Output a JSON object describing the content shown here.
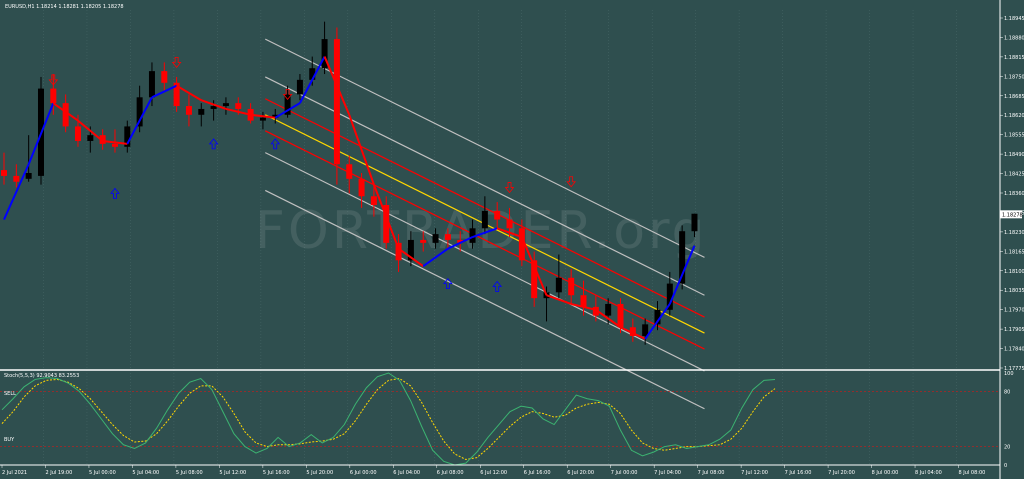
{
  "colors": {
    "background": "#2f4f4f",
    "grid": "#4a6a6a",
    "bull_candle": "#000000",
    "bear_candle": "#ff0000",
    "ma_down": "#ff0000",
    "ma_up": "#0000ff",
    "channel_outer": "#c0c0c0",
    "channel_inner": "#ff0000",
    "channel_mid": "#ffd700",
    "stoch_main": "#3cb371",
    "stoch_signal": "#ffd700",
    "level_line": "#b22222",
    "axis_text": "#ffffff",
    "current_price_box": "#ffffff"
  },
  "header": {
    "title": "EURUSD,H1  1.18214 1.18281 1.18205 1.18278"
  },
  "watermark": "FORTRADER.org",
  "price_axis": {
    "labels": [
      "1.18945",
      "1.18880",
      "1.18815",
      "1.18750",
      "1.18685",
      "1.18620",
      "1.18555",
      "1.18490",
      "1.18425",
      "1.18360",
      "1.18295",
      "1.18230",
      "1.18165",
      "1.18100",
      "1.18035",
      "1.17970",
      "1.17905",
      "1.17840",
      "1.17775"
    ],
    "current_price": "1.18278"
  },
  "time_axis": {
    "labels": [
      "2 Jul 2021",
      "2 Jul 19:00",
      "5 Jul 00:00",
      "5 Jul 04:00",
      "5 Jul 08:00",
      "5 Jul 12:00",
      "5 Jul 16:00",
      "5 Jul 20:00",
      "6 Jul 00:00",
      "6 Jul 04:00",
      "6 Jul 08:00",
      "6 Jul 12:00",
      "6 Jul 16:00",
      "6 Jul 20:00",
      "7 Jul 00:00",
      "7 Jul 04:00",
      "7 Jul 08:00",
      "7 Jul 12:00",
      "7 Jul 16:00",
      "7 Jul 20:00",
      "8 Jul 00:00",
      "8 Jul 04:00",
      "8 Jul 08:00"
    ]
  },
  "stochastic": {
    "title": "Stoch(5,5,3) 92.9043 83.2553",
    "sell_label": "SELL",
    "buy_label": "BUY",
    "axis_labels": [
      "100",
      "80",
      "20",
      "0"
    ],
    "upper_level": 80,
    "lower_level": 20,
    "main": [
      60,
      72,
      85,
      93,
      95,
      94,
      89,
      80,
      66,
      50,
      34,
      22,
      18,
      24,
      40,
      60,
      78,
      90,
      94,
      82,
      58,
      34,
      20,
      13,
      18,
      30,
      20,
      24,
      33,
      24,
      30,
      44,
      66,
      84,
      96,
      100,
      92,
      70,
      42,
      16,
      4,
      0,
      2,
      14,
      30,
      44,
      58,
      64,
      62,
      50,
      44,
      60,
      76,
      72,
      70,
      64,
      38,
      16,
      10,
      14,
      20,
      22,
      18,
      20,
      22,
      28,
      38,
      62,
      82,
      92,
      93
    ],
    "signal": [
      45,
      58,
      74,
      86,
      92,
      93,
      90,
      83,
      72,
      58,
      44,
      32,
      25,
      26,
      34,
      48,
      64,
      78,
      86,
      86,
      74,
      56,
      36,
      24,
      20,
      22,
      22,
      23,
      25,
      26,
      28,
      34,
      48,
      66,
      82,
      92,
      94,
      86,
      68,
      46,
      26,
      12,
      6,
      8,
      18,
      30,
      42,
      52,
      58,
      56,
      52,
      54,
      62,
      66,
      68,
      66,
      56,
      38,
      24,
      18,
      16,
      18,
      20,
      20,
      21,
      22,
      28,
      40,
      58,
      74,
      83
    ]
  },
  "chart_data": {
    "type": "candlestick",
    "title": "EURUSD,H1  1.18214 1.18281 1.18205 1.18278",
    "y_range": [
      1.1775,
      1.1898
    ],
    "candles": [
      {
        "o": 1.1843,
        "h": 1.1849,
        "l": 1.1838,
        "c": 1.1841
      },
      {
        "o": 1.1841,
        "h": 1.1845,
        "l": 1.1837,
        "c": 1.1839
      },
      {
        "o": 1.184,
        "h": 1.1855,
        "l": 1.1839,
        "c": 1.1842
      },
      {
        "o": 1.1841,
        "h": 1.1875,
        "l": 1.1838,
        "c": 1.1871
      },
      {
        "o": 1.1871,
        "h": 1.1876,
        "l": 1.1862,
        "c": 1.1866
      },
      {
        "o": 1.1866,
        "h": 1.1869,
        "l": 1.1856,
        "c": 1.1858
      },
      {
        "o": 1.1858,
        "h": 1.1862,
        "l": 1.1851,
        "c": 1.1853
      },
      {
        "o": 1.1853,
        "h": 1.1858,
        "l": 1.1849,
        "c": 1.1855
      },
      {
        "o": 1.1855,
        "h": 1.1857,
        "l": 1.185,
        "c": 1.1852
      },
      {
        "o": 1.1852,
        "h": 1.1857,
        "l": 1.1849,
        "c": 1.1851
      },
      {
        "o": 1.1851,
        "h": 1.186,
        "l": 1.1849,
        "c": 1.1858
      },
      {
        "o": 1.1858,
        "h": 1.1872,
        "l": 1.1856,
        "c": 1.1868
      },
      {
        "o": 1.1868,
        "h": 1.188,
        "l": 1.1865,
        "c": 1.1877
      },
      {
        "o": 1.1877,
        "h": 1.188,
        "l": 1.187,
        "c": 1.1873
      },
      {
        "o": 1.1873,
        "h": 1.1875,
        "l": 1.1863,
        "c": 1.1865
      },
      {
        "o": 1.1865,
        "h": 1.1869,
        "l": 1.1858,
        "c": 1.1862
      },
      {
        "o": 1.1862,
        "h": 1.1866,
        "l": 1.1858,
        "c": 1.1864
      },
      {
        "o": 1.1864,
        "h": 1.1867,
        "l": 1.186,
        "c": 1.1865
      },
      {
        "o": 1.1865,
        "h": 1.1868,
        "l": 1.1862,
        "c": 1.1866
      },
      {
        "o": 1.1866,
        "h": 1.1868,
        "l": 1.1862,
        "c": 1.1864
      },
      {
        "o": 1.1864,
        "h": 1.1866,
        "l": 1.1859,
        "c": 1.186
      },
      {
        "o": 1.186,
        "h": 1.1863,
        "l": 1.1857,
        "c": 1.1861
      },
      {
        "o": 1.1861,
        "h": 1.1864,
        "l": 1.1859,
        "c": 1.1862
      },
      {
        "o": 1.1862,
        "h": 1.1872,
        "l": 1.1861,
        "c": 1.1869
      },
      {
        "o": 1.1869,
        "h": 1.1876,
        "l": 1.1867,
        "c": 1.1874
      },
      {
        "o": 1.1874,
        "h": 1.1882,
        "l": 1.1872,
        "c": 1.1878
      },
      {
        "o": 1.1878,
        "h": 1.1894,
        "l": 1.1876,
        "c": 1.1888
      },
      {
        "o": 1.1888,
        "h": 1.1892,
        "l": 1.1838,
        "c": 1.1845
      },
      {
        "o": 1.1845,
        "h": 1.1848,
        "l": 1.1835,
        "c": 1.184
      },
      {
        "o": 1.184,
        "h": 1.1842,
        "l": 1.183,
        "c": 1.1834
      },
      {
        "o": 1.1834,
        "h": 1.1838,
        "l": 1.1827,
        "c": 1.1831
      },
      {
        "o": 1.1831,
        "h": 1.1834,
        "l": 1.1816,
        "c": 1.1818
      },
      {
        "o": 1.1818,
        "h": 1.1821,
        "l": 1.1808,
        "c": 1.1812
      },
      {
        "o": 1.1812,
        "h": 1.1822,
        "l": 1.181,
        "c": 1.1819
      },
      {
        "o": 1.1819,
        "h": 1.1822,
        "l": 1.1815,
        "c": 1.1818
      },
      {
        "o": 1.1818,
        "h": 1.1823,
        "l": 1.1816,
        "c": 1.1821
      },
      {
        "o": 1.1821,
        "h": 1.1823,
        "l": 1.1816,
        "c": 1.1819
      },
      {
        "o": 1.1819,
        "h": 1.1822,
        "l": 1.1815,
        "c": 1.1818
      },
      {
        "o": 1.1818,
        "h": 1.1826,
        "l": 1.1816,
        "c": 1.1823
      },
      {
        "o": 1.1823,
        "h": 1.1834,
        "l": 1.1821,
        "c": 1.1829
      },
      {
        "o": 1.1829,
        "h": 1.1832,
        "l": 1.1823,
        "c": 1.1826
      },
      {
        "o": 1.1826,
        "h": 1.183,
        "l": 1.182,
        "c": 1.1823
      },
      {
        "o": 1.1823,
        "h": 1.1826,
        "l": 1.181,
        "c": 1.1812
      },
      {
        "o": 1.1812,
        "h": 1.1815,
        "l": 1.1796,
        "c": 1.1799
      },
      {
        "o": 1.1799,
        "h": 1.1803,
        "l": 1.1791,
        "c": 1.1801
      },
      {
        "o": 1.1801,
        "h": 1.1814,
        "l": 1.1799,
        "c": 1.1806
      },
      {
        "o": 1.1806,
        "h": 1.1809,
        "l": 1.1797,
        "c": 1.18
      },
      {
        "o": 1.18,
        "h": 1.1805,
        "l": 1.1793,
        "c": 1.1796
      },
      {
        "o": 1.1796,
        "h": 1.18,
        "l": 1.1791,
        "c": 1.1793
      },
      {
        "o": 1.1793,
        "h": 1.1799,
        "l": 1.179,
        "c": 1.1797
      },
      {
        "o": 1.1797,
        "h": 1.1799,
        "l": 1.1787,
        "c": 1.1789
      },
      {
        "o": 1.1789,
        "h": 1.1792,
        "l": 1.1784,
        "c": 1.1786
      },
      {
        "o": 1.1786,
        "h": 1.1792,
        "l": 1.1783,
        "c": 1.179
      },
      {
        "o": 1.179,
        "h": 1.1798,
        "l": 1.1788,
        "c": 1.1795
      },
      {
        "o": 1.1795,
        "h": 1.1808,
        "l": 1.1793,
        "c": 1.1804
      },
      {
        "o": 1.1804,
        "h": 1.1824,
        "l": 1.1802,
        "c": 1.1822
      },
      {
        "o": 1.1822,
        "h": 1.1828,
        "l": 1.182,
        "c": 1.1828
      }
    ],
    "ma_line": [
      {
        "i": 0,
        "v": 1.1826
      },
      {
        "i": 2,
        "v": 1.1845
      },
      {
        "i": 4,
        "v": 1.1866
      },
      {
        "i": 6,
        "v": 1.186
      },
      {
        "i": 8,
        "v": 1.1853
      },
      {
        "i": 10,
        "v": 1.1852
      },
      {
        "i": 12,
        "v": 1.1868
      },
      {
        "i": 14,
        "v": 1.1872
      },
      {
        "i": 16,
        "v": 1.1867
      },
      {
        "i": 18,
        "v": 1.1864
      },
      {
        "i": 20,
        "v": 1.1862
      },
      {
        "i": 22,
        "v": 1.1861
      },
      {
        "i": 24,
        "v": 1.1866
      },
      {
        "i": 26,
        "v": 1.1882
      },
      {
        "i": 28,
        "v": 1.1862
      },
      {
        "i": 30,
        "v": 1.1838
      },
      {
        "i": 32,
        "v": 1.1816
      },
      {
        "i": 34,
        "v": 1.181
      },
      {
        "i": 36,
        "v": 1.1816
      },
      {
        "i": 38,
        "v": 1.182
      },
      {
        "i": 40,
        "v": 1.1823
      },
      {
        "i": 42,
        "v": 1.182
      },
      {
        "i": 44,
        "v": 1.18
      },
      {
        "i": 46,
        "v": 1.1797
      },
      {
        "i": 48,
        "v": 1.1795
      },
      {
        "i": 50,
        "v": 1.1789
      },
      {
        "i": 52,
        "v": 1.1785
      },
      {
        "i": 54,
        "v": 1.1797
      },
      {
        "i": 56,
        "v": 1.1817
      }
    ],
    "channel": {
      "start_index": 22,
      "end_index": 56,
      "mid_start": 1.1862,
      "mid_end": 1.1787,
      "inner_offset": 0.00055,
      "outer_offset": 0.0013
    },
    "arrows": [
      {
        "i": 4,
        "dir": "down",
        "v": 1.1874
      },
      {
        "i": 14,
        "dir": "down",
        "v": 1.188
      },
      {
        "i": 23,
        "dir": "down",
        "v": 1.1869
      },
      {
        "i": 9,
        "dir": "up",
        "v": 1.1835
      },
      {
        "i": 17,
        "dir": "up",
        "v": 1.1852
      },
      {
        "i": 22,
        "dir": "up",
        "v": 1.1852
      },
      {
        "i": 36,
        "dir": "up",
        "v": 1.1804
      },
      {
        "i": 41,
        "dir": "down",
        "v": 1.1837
      },
      {
        "i": 40,
        "dir": "up",
        "v": 1.1803
      },
      {
        "i": 46,
        "dir": "down",
        "v": 1.1839
      }
    ]
  }
}
